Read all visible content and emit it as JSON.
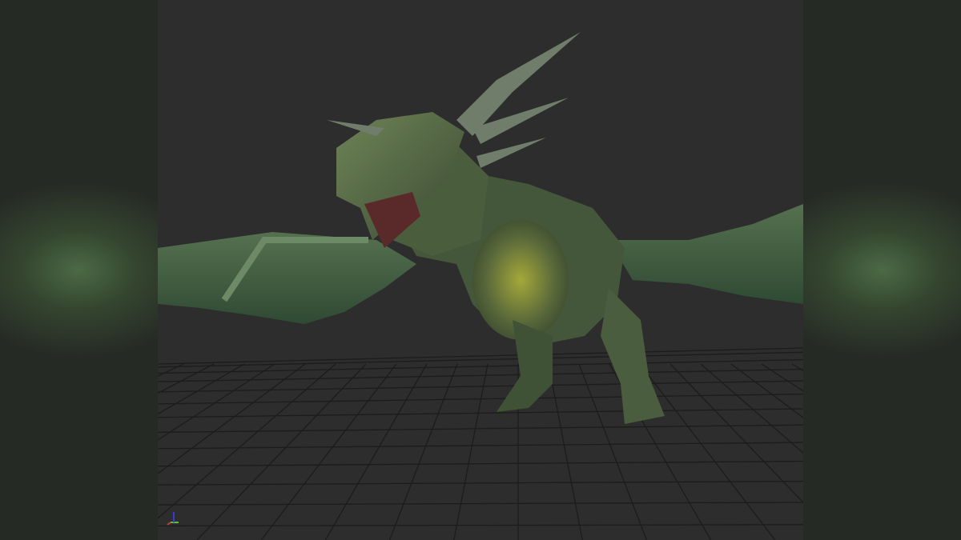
{
  "viewport": {
    "background_color": "#2d2d2d",
    "grid_color": "#1c1c1c",
    "model_color": "#4f6a42"
  },
  "axis_gizmo": {
    "x_color": "#c0402a",
    "y_color": "#5fbf3a",
    "z_color": "#3a3ad0"
  }
}
